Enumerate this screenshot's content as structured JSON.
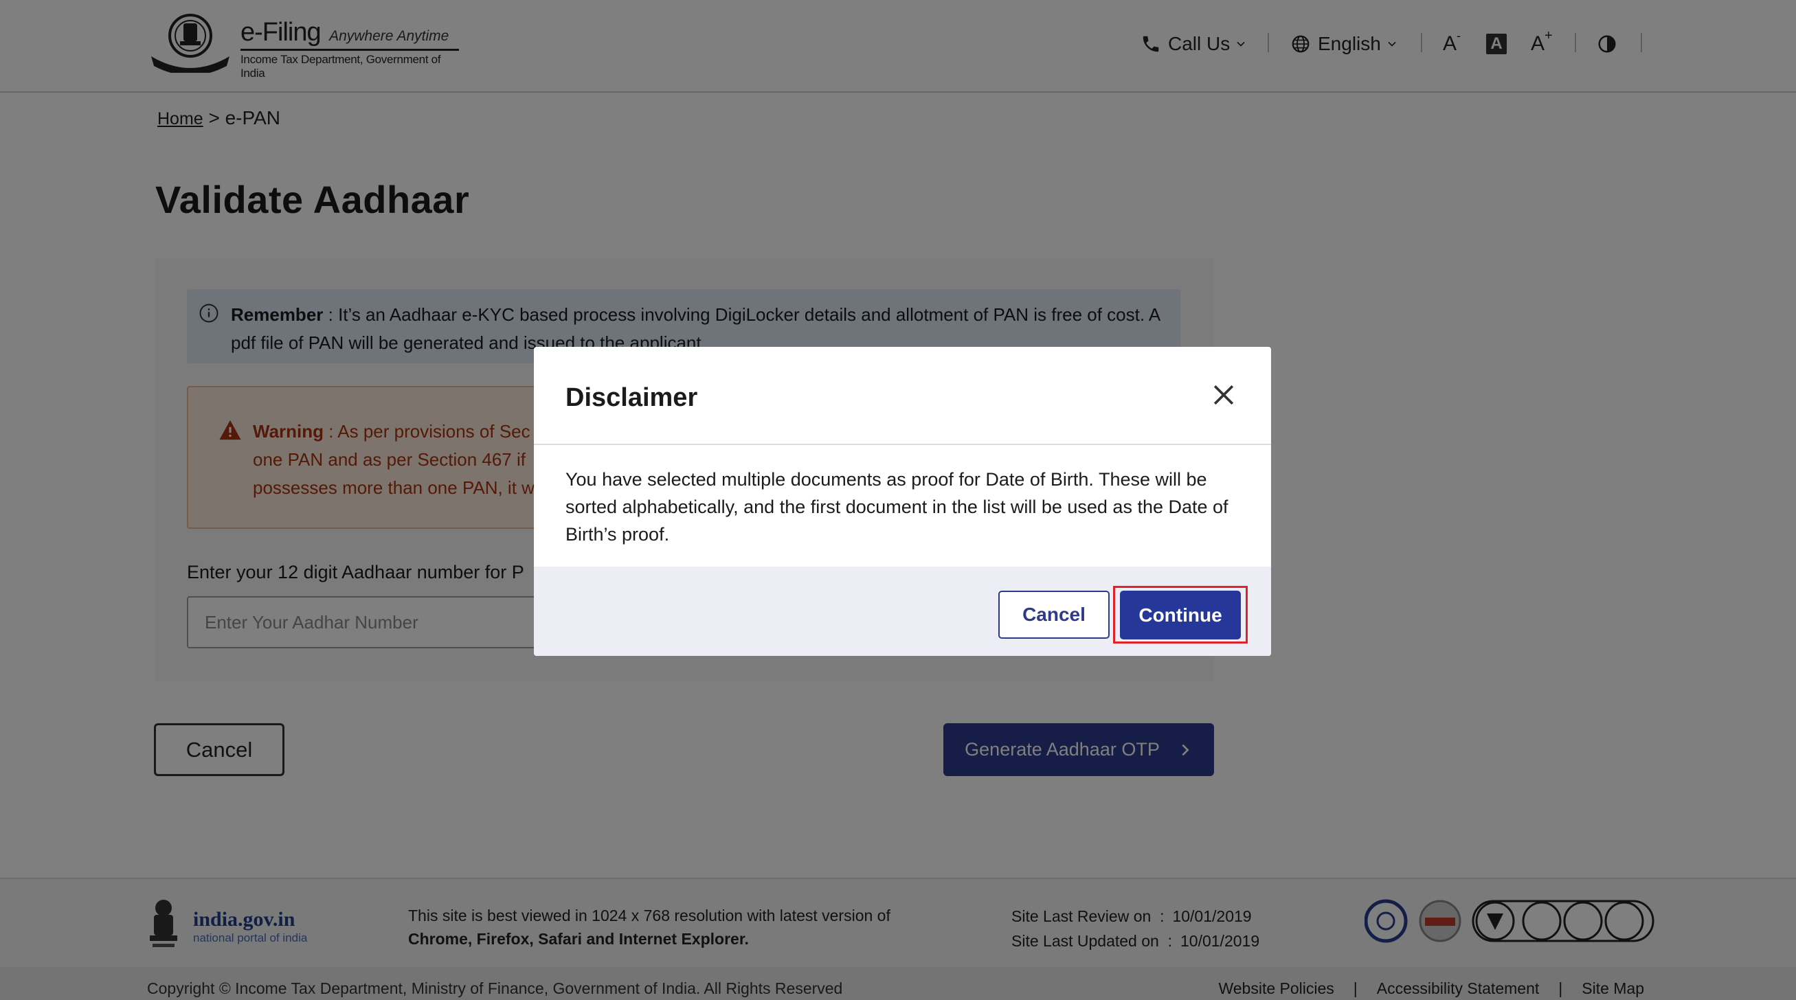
{
  "header": {
    "brand_title": "e-Filing",
    "brand_tagline": "Anywhere Anytime",
    "brand_subtitle": "Income Tax Department, Government of India",
    "call_us": "Call Us",
    "language": "English",
    "font_decrease": "A",
    "font_reset": "A",
    "font_increase": "A"
  },
  "breadcrumb": {
    "home": "Home",
    "sep": ">",
    "current": "e-PAN"
  },
  "page": {
    "title": "Validate Aadhaar",
    "remember_label": "Remember",
    "remember_text": " : It’s an Aadhaar e-KYC based process involving DigiLocker details  and allotment of PAN is free of cost. A pdf file of PAN will be generated and issued to the applicant",
    "warning_label": "Warning",
    "warning_text": " :  As per provisions of Sec",
    "warning_line2": "one PAN and as per Section 467 if",
    "warning_line3": "possesses more than one PAN, it w",
    "aadhaar_label": "Enter your 12 digit Aadhaar number for P",
    "aadhaar_placeholder": "Enter Your Aadhar Number",
    "cancel_label": "Cancel",
    "otp_label": "Generate Aadhaar OTP"
  },
  "footer": {
    "india_gov": "india.gov.in",
    "india_sub": "national portal of india",
    "best_viewed_line1": "This site is best viewed in 1024 x 768 resolution with latest version of",
    "best_viewed_line2": "Chrome, Firefox, Safari and Internet Explorer.",
    "review_label": "Site Last Review on",
    "review_colon": ":",
    "review_date": "10/01/2019",
    "updated_label": "Site Last Updated on",
    "updated_colon": ":",
    "updated_date": "10/01/2019",
    "copyright": "Copyright © Income Tax Department, Ministry of Finance, Government of India. All Rights Reserved",
    "links": [
      "Website Policies",
      "|",
      "Accessibility Statement",
      "|",
      "Site Map"
    ]
  },
  "modal": {
    "title": "Disclaimer",
    "body": "You have selected multiple documents as proof for Date of Birth. These will be sorted alphabetically, and the first document in the list will be used as the Date of Birth’s proof.",
    "cancel_label": "Cancel",
    "continue_label": "Continue"
  },
  "colors": {
    "primary": "#26379a",
    "highlight": "#e0232b",
    "warning_text": "#a8350e",
    "info_bg": "#dfe8f4"
  },
  "icons": [
    "emblem-icon",
    "phone-icon",
    "chevron-down-icon",
    "globe-icon",
    "font-decrease-icon",
    "font-reset-icon",
    "font-increase-icon",
    "contrast-icon",
    "info-icon",
    "warning-icon",
    "chevron-right-icon",
    "close-icon",
    "certification-badge-icon"
  ]
}
